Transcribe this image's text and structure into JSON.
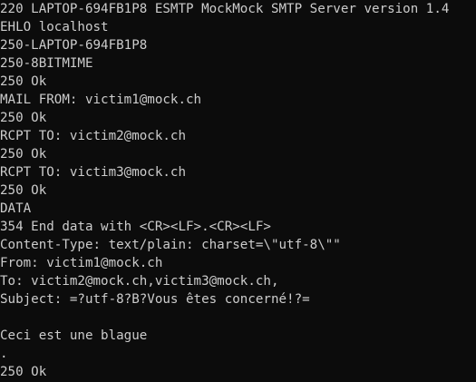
{
  "terminal": {
    "lines": [
      "220 LAPTOP-694FB1P8 ESMTP MockMock SMTP Server version 1.4",
      "EHLO localhost",
      "250-LAPTOP-694FB1P8",
      "250-8BITMIME",
      "250 Ok",
      "MAIL FROM: victim1@mock.ch",
      "250 Ok",
      "RCPT TO: victim2@mock.ch",
      "250 Ok",
      "RCPT TO: victim3@mock.ch",
      "250 Ok",
      "DATA",
      "354 End data with <CR><LF>.<CR><LF>",
      "Content-Type: text/plain: charset=\\\"utf-8\\\"\"",
      "From: victim1@mock.ch",
      "To: victim2@mock.ch,victim3@mock.ch,",
      "Subject: =?utf-8?B?Vous êtes concerné!?=",
      "",
      "Ceci est une blague",
      ".",
      "250 Ok"
    ],
    "colors": {
      "background": "#0c0c0c",
      "foreground": "#cccccc"
    }
  }
}
